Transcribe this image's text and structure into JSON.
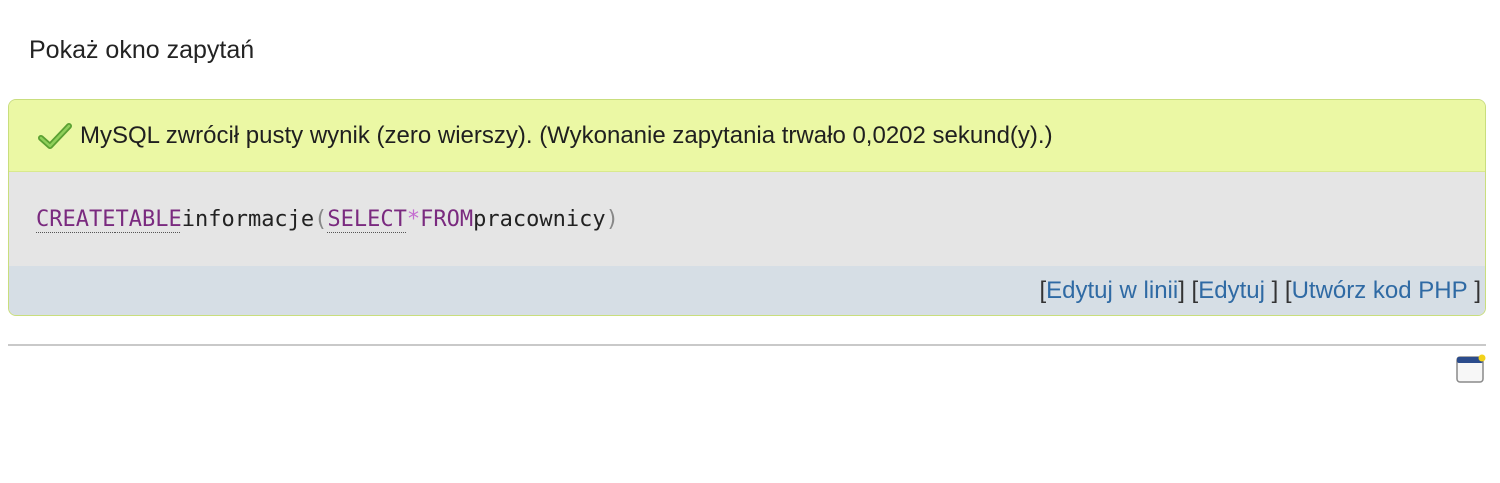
{
  "query_window": {
    "link_label": "Pokaż okno zapytań"
  },
  "result": {
    "success_icon": "checkmark-icon",
    "message": "MySQL zwrócił pusty wynik (zero wierszy). (Wykonanie zapytania trwało 0,0202 sekund(y).)",
    "sql": {
      "kw_create": "CREATE",
      "kw_table": "TABLE",
      "table_name": "informacje",
      "open_paren": "(",
      "kw_select": "SELECT",
      "star": "*",
      "kw_from": "FROM",
      "source_table": "pracownicy",
      "close_paren": ")"
    },
    "actions": {
      "open_1": "[",
      "edit_inline": "Edytuj w linii",
      "close_1": "] [",
      "edit": "Edytuj",
      "close_2": " ] [",
      "create_php": "Utwórz kod PHP",
      "close_3": " ]"
    }
  },
  "footer": {
    "bookmark_icon": "bookmark-icon"
  },
  "colors": {
    "success_bg": "#ebf8a4",
    "sql_bg": "#e5e5e5",
    "actions_bg": "#d6dee5",
    "link": "#2f6aa4",
    "keyword": "#7a2a7f",
    "check": "#5aa032"
  }
}
